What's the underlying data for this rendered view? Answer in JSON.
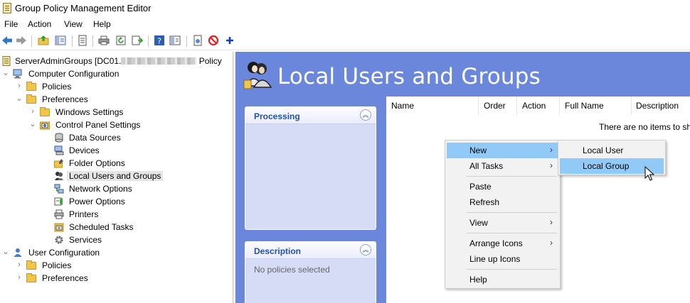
{
  "window": {
    "title": "Group Policy Management Editor"
  },
  "menubar": {
    "items": [
      "File",
      "Action",
      "View",
      "Help"
    ]
  },
  "toolbar": {
    "icons": [
      "back-arrow-icon",
      "forward-arrow-icon",
      "up-folder-icon",
      "show-hide-tree-icon",
      "properties-icon",
      "print-icon",
      "refresh-icon",
      "export-list-icon",
      "help-icon",
      "help-topics-icon",
      "new-item-icon",
      "disable-icon",
      "add-icon"
    ]
  },
  "tree": {
    "root": {
      "label_prefix": "ServerAdminGroups [DC01.",
      "label_suffix": " Policy"
    },
    "items": [
      {
        "label": "Computer Configuration"
      },
      {
        "label": "Policies"
      },
      {
        "label": "Preferences"
      },
      {
        "label": "Windows Settings"
      },
      {
        "label": "Control Panel Settings"
      },
      {
        "label": "Data Sources"
      },
      {
        "label": "Devices"
      },
      {
        "label": "Folder Options"
      },
      {
        "label": "Local Users and Groups"
      },
      {
        "label": "Network Options"
      },
      {
        "label": "Power Options"
      },
      {
        "label": "Printers"
      },
      {
        "label": "Scheduled Tasks"
      },
      {
        "label": "Services"
      },
      {
        "label": "User Configuration"
      },
      {
        "label": "Policies"
      },
      {
        "label": "Preferences"
      }
    ]
  },
  "content": {
    "header_title": "Local Users and Groups",
    "processing_panel": {
      "title": "Processing"
    },
    "description_panel": {
      "title": "Description",
      "body": "No policies selected"
    },
    "columns": [
      "Name",
      "Order",
      "Action",
      "Full Name",
      "Description"
    ],
    "empty_message": "There are no items to sh"
  },
  "context_menu": {
    "items": [
      "New",
      "All Tasks",
      "Paste",
      "Refresh",
      "View",
      "Arrange Icons",
      "Line up Icons",
      "Help"
    ],
    "highlighted": "New"
  },
  "submenu": {
    "items": [
      "Local User",
      "Local Group"
    ],
    "highlighted": "Local Group"
  },
  "colors": {
    "content_bg": "#6a87dc",
    "highlight": "#91c9f7",
    "panel_title": "#2450a8"
  }
}
